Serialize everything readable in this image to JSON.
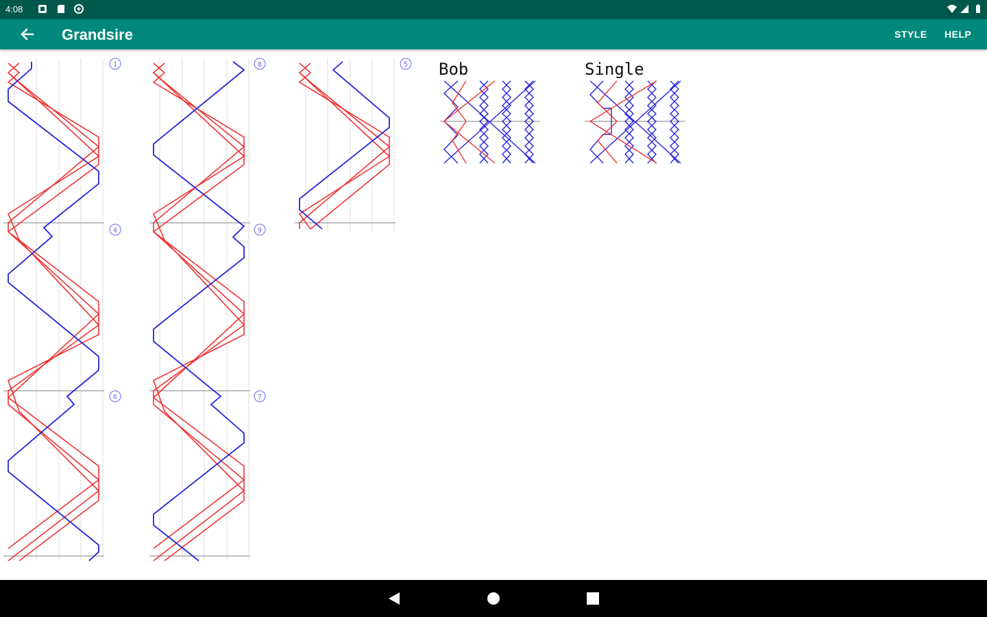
{
  "status_bar": {
    "time": "4:08",
    "left_icons": [
      "notification-icon",
      "sd-card-icon",
      "sync-icon"
    ],
    "right_icons": [
      "wifi-icon",
      "cell-signal-icon",
      "battery-icon"
    ]
  },
  "app_bar": {
    "title": "Grandsire",
    "back_icon": "arrow-back-icon",
    "actions": [
      "STYLE",
      "HELP"
    ]
  },
  "diagram": {
    "lead_numbers": [
      "1",
      "8",
      "5",
      "4",
      "9",
      "6",
      "7"
    ],
    "call_titles": [
      "Bob",
      "Single"
    ],
    "colors": {
      "treble_lines": "#ee3333",
      "working_line": "#2222dd",
      "place_line": "#bbbbbb",
      "lead_end_line": "#aaaaaa",
      "lead_marker": "#6666ee"
    }
  },
  "nav_bar": {
    "icons": [
      "back-triangle-icon",
      "home-circle-icon",
      "recents-square-icon"
    ]
  }
}
